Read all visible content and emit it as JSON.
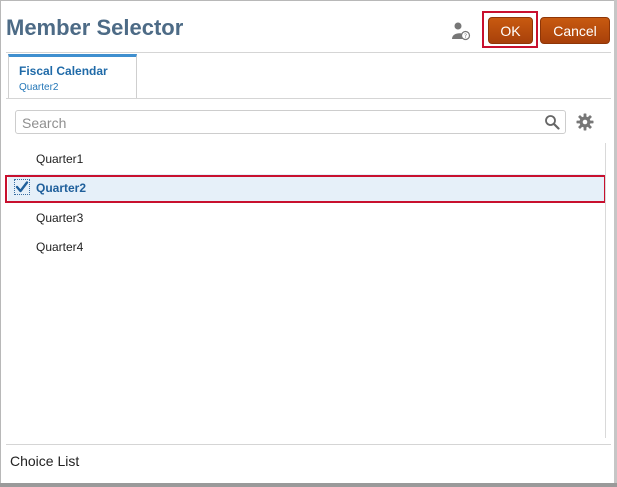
{
  "dialog": {
    "title": "Member Selector",
    "ok_label": "OK",
    "cancel_label": "Cancel"
  },
  "tab": {
    "title": "Fiscal Calendar",
    "selected_value": "Quarter2"
  },
  "search": {
    "placeholder": "Search"
  },
  "members": [
    {
      "label": "Quarter1",
      "selected": false
    },
    {
      "label": "Quarter2",
      "selected": true
    },
    {
      "label": "Quarter3",
      "selected": false
    },
    {
      "label": "Quarter4",
      "selected": false
    }
  ],
  "footer": {
    "label": "Choice List"
  },
  "colors": {
    "accent_button": "#b84b0d",
    "title_color": "#4d6b86",
    "highlight_red": "#c8102e",
    "selection_bg": "#e6f0f9"
  }
}
